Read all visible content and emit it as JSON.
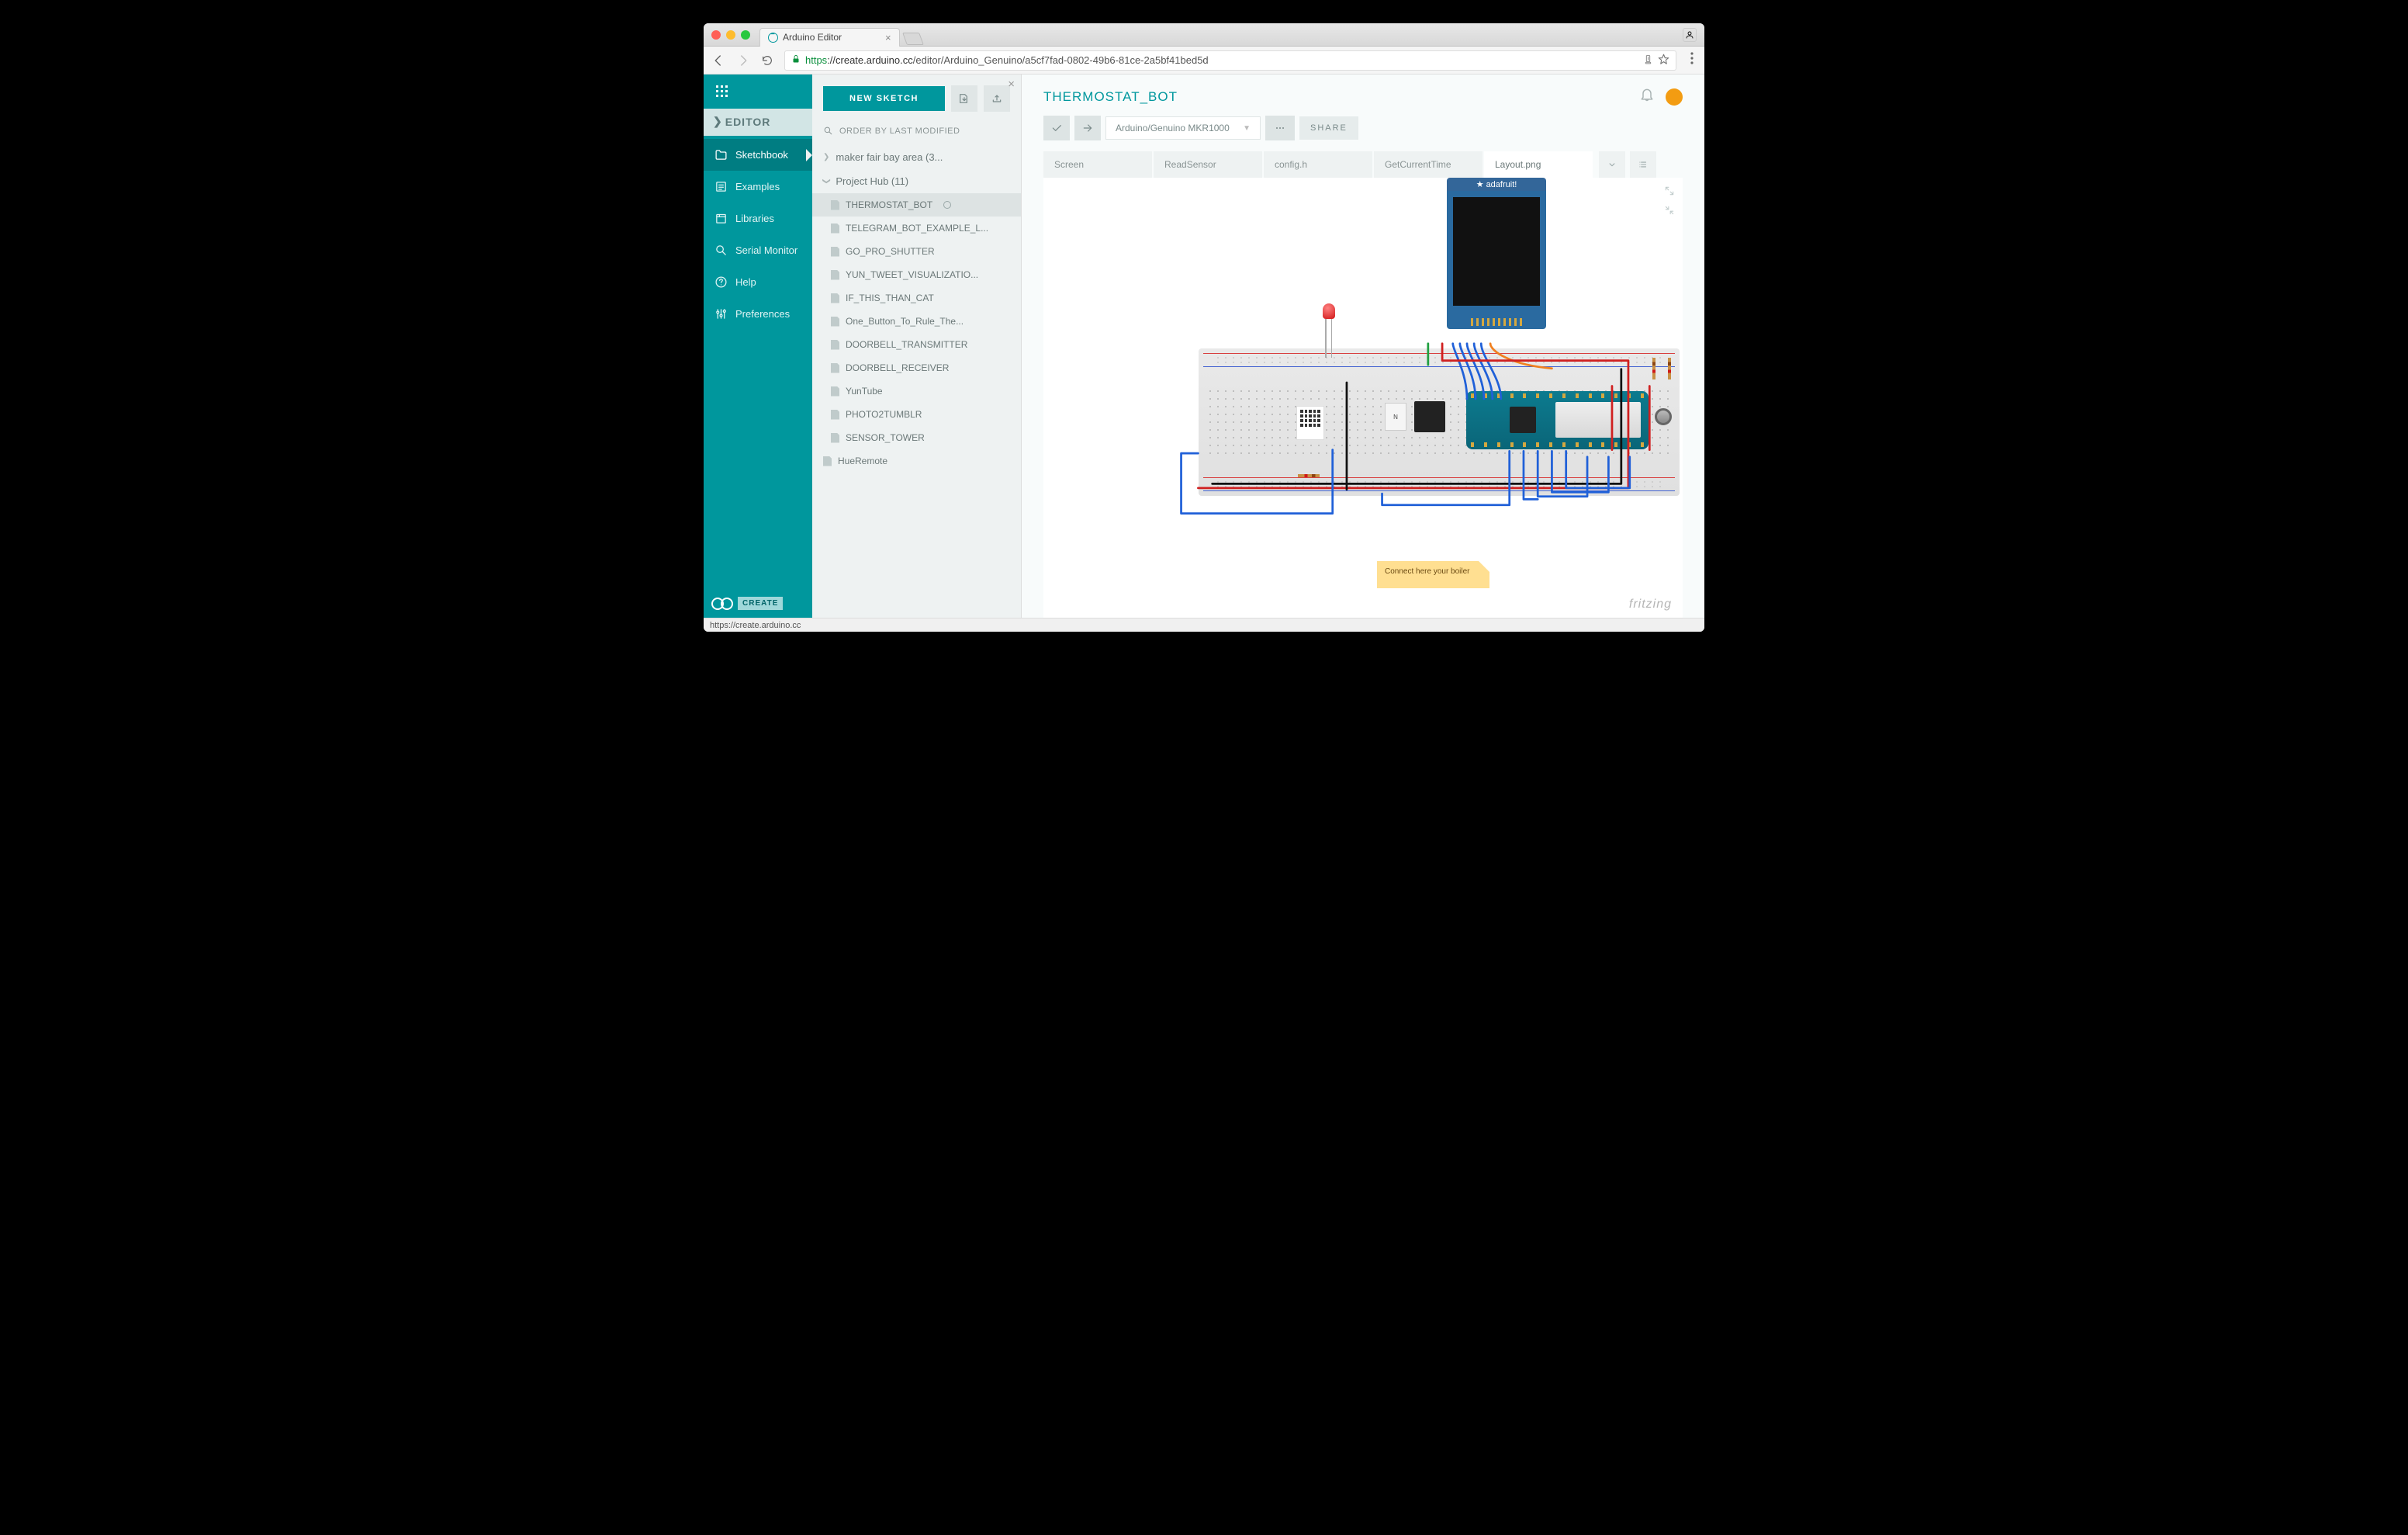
{
  "browser": {
    "tab_title": "Arduino Editor",
    "url_secure": "https",
    "url_host": "://create.arduino.cc",
    "url_path": "/editor/Arduino_Genuino/a5cf7fad-0802-49b6-81ce-2a5bf41bed5d",
    "status_text": "https://create.arduino.cc"
  },
  "brand": "EDITOR",
  "nav": [
    {
      "label": "Sketchbook"
    },
    {
      "label": "Examples"
    },
    {
      "label": "Libraries"
    },
    {
      "label": "Serial Monitor"
    },
    {
      "label": "Help"
    },
    {
      "label": "Preferences"
    }
  ],
  "create_badge": "CREATE",
  "file_panel": {
    "new_sketch": "NEW SKETCH",
    "order_label": "ORDER BY LAST MODIFIED",
    "folders": [
      {
        "name": "maker fair bay area (3...",
        "expanded": false
      },
      {
        "name": "Project Hub (11)",
        "expanded": true,
        "items": [
          "THERMOSTAT_BOT",
          "TELEGRAM_BOT_EXAMPLE_L...",
          "GO_PRO_SHUTTER",
          "YUN_TWEET_VISUALIZATIO...",
          "IF_THIS_THAN_CAT",
          "One_Button_To_Rule_The...",
          "DOORBELL_TRANSMITTER",
          "DOORBELL_RECEIVER",
          "YunTube",
          "PHOTO2TUMBLR",
          "SENSOR_TOWER"
        ]
      }
    ],
    "loose": [
      "HueRemote"
    ]
  },
  "project": {
    "title": "THERMOSTAT_BOT",
    "board": "Arduino/Genuino MKR1000",
    "share": "SHARE",
    "tabs": [
      "Screen",
      "ReadSensor",
      "config.h",
      "GetCurrentTime",
      "Layout.png"
    ],
    "active_tab": 4,
    "display_brand": "adafruit!",
    "note_text": "Connect here your boiler",
    "fritzing": "fritzing",
    "transistor_label": "N"
  }
}
